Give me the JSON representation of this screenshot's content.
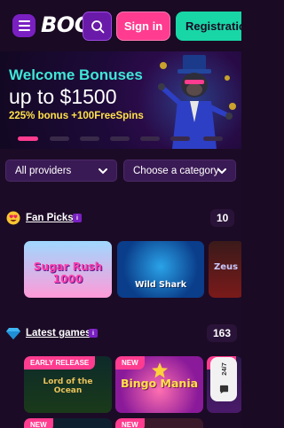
{
  "header": {
    "logo": "BOOi!",
    "signin_label": "Sign in",
    "register_label": "Registration"
  },
  "banner": {
    "title": "Welcome Bonuses",
    "amount": "up to $1500",
    "subtitle": "225% bonus +100FreeSpins",
    "slides_total": 7,
    "active_slide": 1
  },
  "filters": {
    "providers_label": "All providers",
    "category_label": "Choose a category"
  },
  "fan_picks": {
    "title": "Fan Picks",
    "info": "i",
    "count": "10",
    "games": [
      {
        "name": "Sugar Rush 1000"
      },
      {
        "name": "Wild Shark"
      },
      {
        "name": "Zeus"
      }
    ]
  },
  "latest_games": {
    "title": "Latest games",
    "info": "i",
    "count": "163",
    "games": [
      {
        "badge": "EARLY RELEASE",
        "name": "Lord of the Ocean"
      },
      {
        "badge": "NEW",
        "name": "Bingo Mania"
      },
      {
        "badge": "NEW",
        "name": ""
      }
    ]
  },
  "chat": {
    "label": "24/7"
  },
  "icons": {
    "menu": "menu-icon",
    "search": "search-icon",
    "fan": "heart-eyes-icon",
    "latest": "diamond-icon",
    "chat": "chat-icon"
  },
  "colors": {
    "accent_pink": "#ff3c8f",
    "accent_teal": "#18d6a6",
    "accent_purple": "#7a1fc2",
    "background": "#1c0b26"
  }
}
